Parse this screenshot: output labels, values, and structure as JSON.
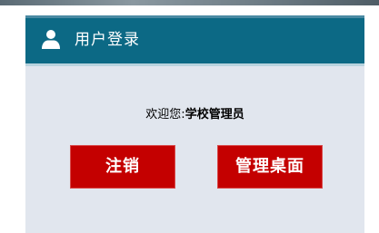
{
  "panel": {
    "title": "用户登录",
    "title_icon": "user-icon"
  },
  "welcome": {
    "prefix": "欢迎您:",
    "user": "学校管理员"
  },
  "buttons": {
    "logout_label": "注销",
    "admin_label": "管理桌面"
  },
  "colors": {
    "header": "#0c6985",
    "panel_bg": "#e1e6ee",
    "button": "#c40000"
  }
}
